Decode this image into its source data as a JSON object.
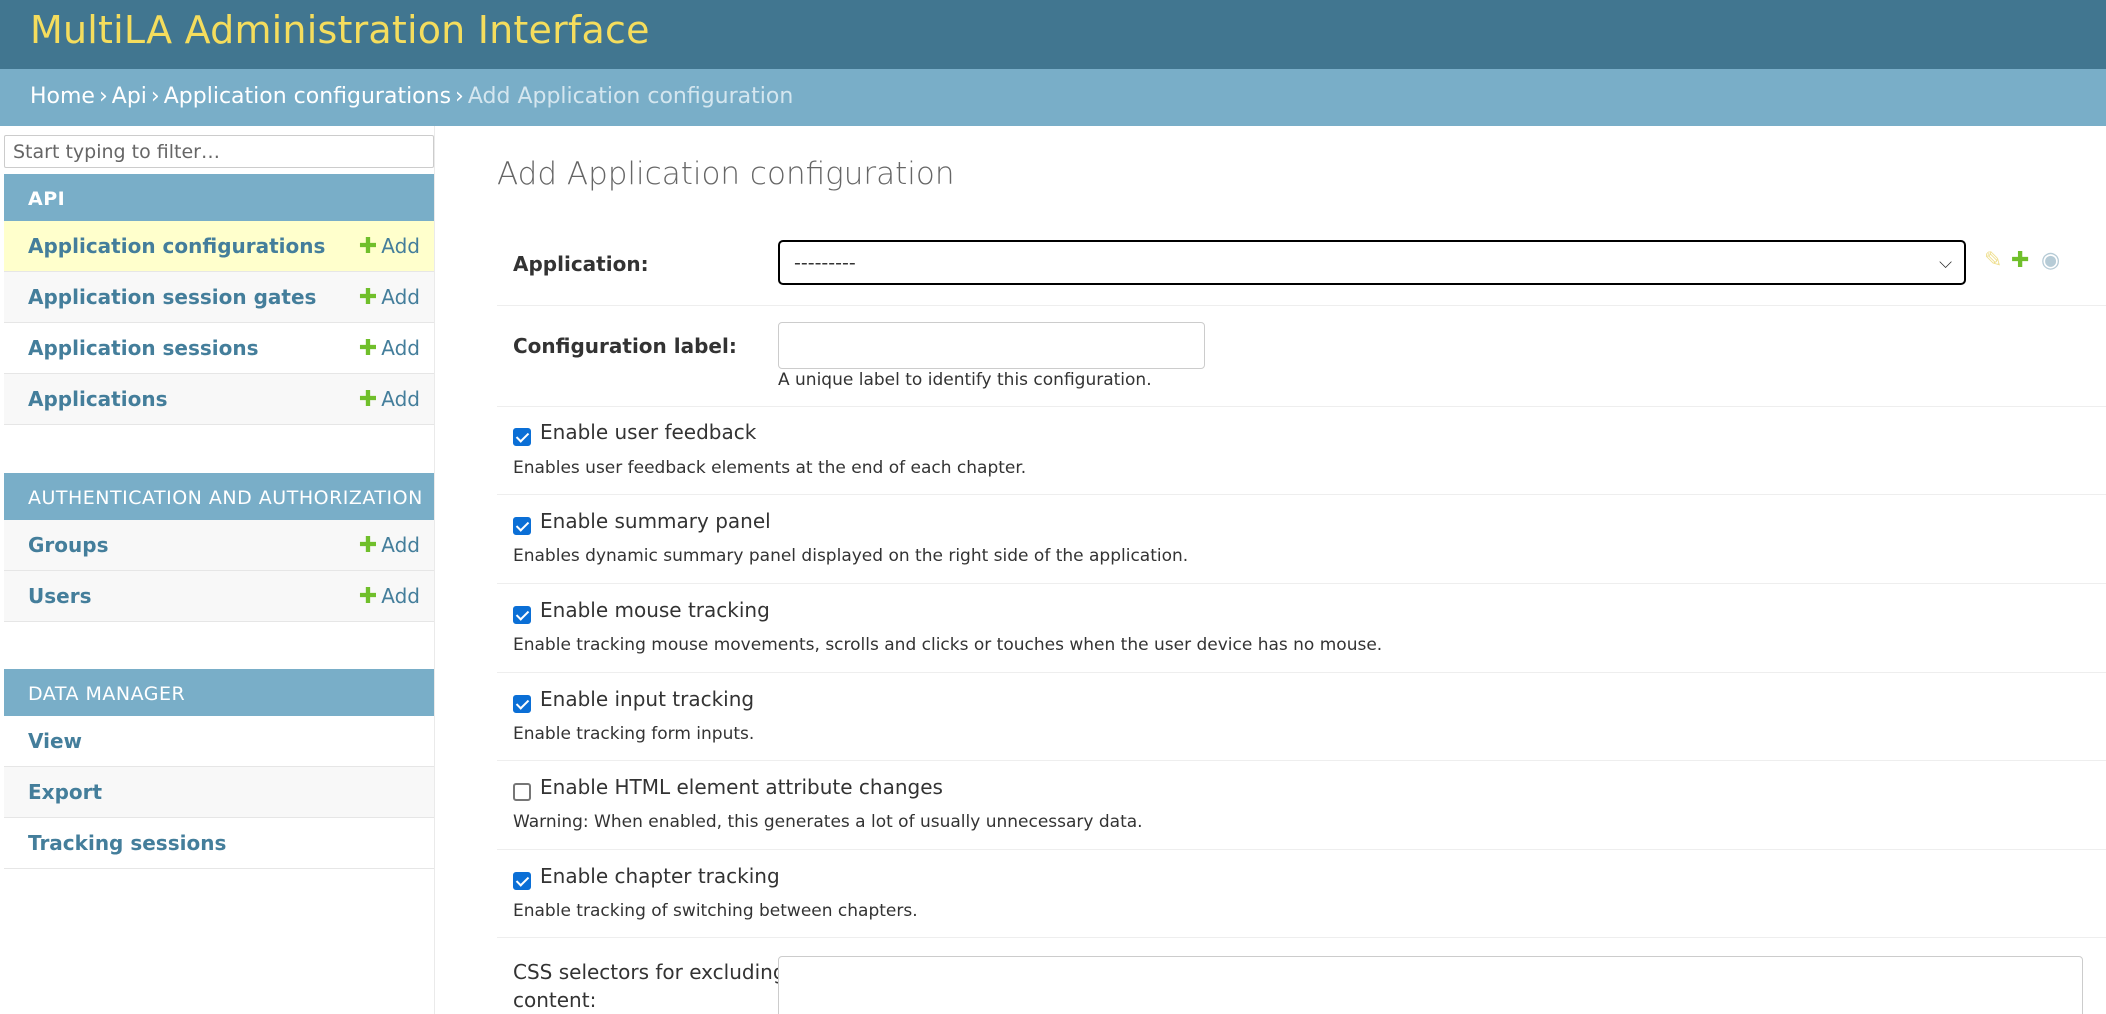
{
  "header": {
    "branding": "MultiLA Administration Interface"
  },
  "breadcrumbs": {
    "items": [
      "Home",
      "Api",
      "Application configurations"
    ],
    "current": "Add Application configuration",
    "separator": "›"
  },
  "sidebar": {
    "filter_placeholder": "Start typing to filter…",
    "add_label": "Add",
    "modules": [
      {
        "caption": "API",
        "items": [
          "Application configurations",
          "Application session gates",
          "Application sessions",
          "Applications"
        ]
      },
      {
        "caption": "AUTHENTICATION AND AUTHORIZATION",
        "items": [
          "Groups",
          "Users"
        ]
      },
      {
        "caption": "DATA MANAGER",
        "items": [
          "View",
          "Export",
          "Tracking sessions"
        ]
      }
    ],
    "selected_item": "Application configurations"
  },
  "content": {
    "title": "Add Application configuration",
    "application": {
      "label": "Application:",
      "selected_value": "---------"
    },
    "config_label": {
      "label": "Configuration label:",
      "help": "A unique label to identify this configuration."
    },
    "checkboxes": [
      {
        "label": "Enable user feedback",
        "checked": true,
        "help": "Enables user feedback elements at the end of each chapter."
      },
      {
        "label": "Enable summary panel",
        "checked": true,
        "help": "Enables dynamic summary panel displayed on the right side of the application."
      },
      {
        "label": "Enable mouse tracking",
        "checked": true,
        "help": "Enable tracking mouse movements, scrolls and clicks or touches when the user device has no mouse."
      },
      {
        "label": "Enable input tracking",
        "checked": true,
        "help": "Enable tracking form inputs."
      },
      {
        "label": "Enable HTML element attribute changes",
        "checked": false,
        "help": "Warning: When enabled, this generates a lot of usually unnecessary data."
      },
      {
        "label": "Enable chapter tracking",
        "checked": true,
        "help": "Enable tracking of switching between chapters."
      }
    ],
    "css_exclude": {
      "label_line1": "CSS selectors for excluding",
      "label_line2": "content:"
    }
  },
  "icons": {
    "edit": "pencil-icon",
    "add": "plus-icon",
    "view": "eye-icon"
  },
  "colors": {
    "header": "#417690",
    "brand": "#f5dd5d",
    "breadcrumbs": "#79aec8",
    "link": "#447e9b",
    "add_plus": "#70bf2b",
    "selected_row": "#ffffcc"
  }
}
